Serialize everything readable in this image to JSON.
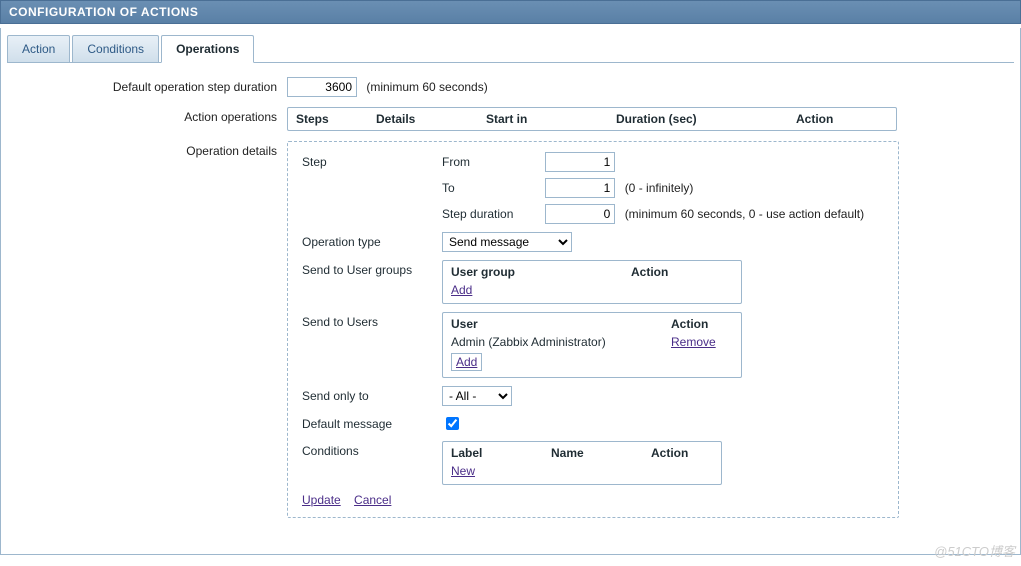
{
  "header": {
    "title": "CONFIGURATION OF ACTIONS"
  },
  "tabs": {
    "action": "Action",
    "conditions": "Conditions",
    "operations": "Operations"
  },
  "form": {
    "default_duration_label": "Default operation step duration",
    "default_duration_value": "3600",
    "default_duration_hint": "(minimum 60 seconds)",
    "action_operations_label": "Action operations",
    "op_headers": {
      "steps": "Steps",
      "details": "Details",
      "start_in": "Start in",
      "duration": "Duration (sec)",
      "action": "Action"
    },
    "operation_details_label": "Operation details",
    "details": {
      "step_label": "Step",
      "from_label": "From",
      "from_value": "1",
      "to_label": "To",
      "to_value": "1",
      "to_hint": "(0 - infinitely)",
      "step_duration_label": "Step duration",
      "step_duration_value": "0",
      "step_duration_hint": "(minimum 60 seconds, 0 - use action default)",
      "op_type_label": "Operation type",
      "op_type_value": "Send message",
      "send_user_groups_label": "Send to User groups",
      "user_group_hdr": "User group",
      "action_hdr": "Action",
      "add_link": "Add",
      "send_users_label": "Send to Users",
      "user_hdr": "User",
      "user_row_name": "Admin (Zabbix Administrator)",
      "remove_link": "Remove",
      "send_only_to_label": "Send only to",
      "send_only_to_value": "- All -",
      "default_message_label": "Default message",
      "conditions_label": "Conditions",
      "cond_label_hdr": "Label",
      "cond_name_hdr": "Name",
      "cond_action_hdr": "Action",
      "new_link": "New"
    },
    "update_label": "Update",
    "cancel_label": "Cancel"
  },
  "watermark": "@51CTO博客"
}
